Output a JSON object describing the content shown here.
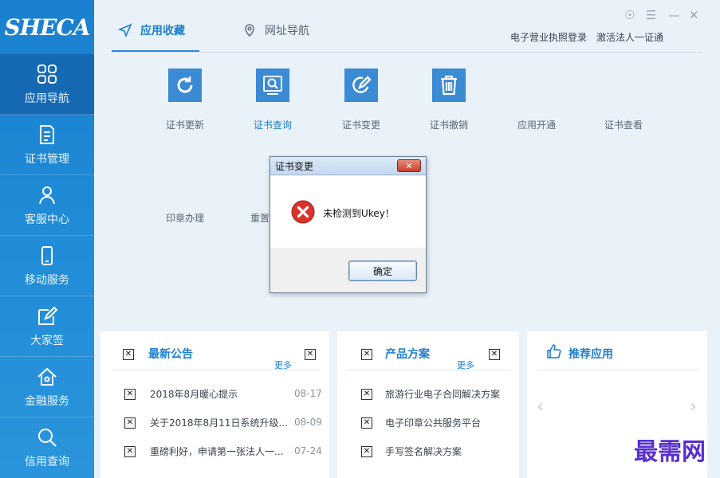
{
  "sidebar": {
    "logo": "SHECA",
    "items": [
      {
        "label": "应用导航",
        "icon": "grid-icon"
      },
      {
        "label": "证书管理",
        "icon": "document-icon"
      },
      {
        "label": "客服中心",
        "icon": "user-icon"
      },
      {
        "label": "移动服务",
        "icon": "phone-icon"
      },
      {
        "label": "大家签",
        "icon": "pen-icon"
      },
      {
        "label": "金融服务",
        "icon": "house-icon"
      },
      {
        "label": "信用查询",
        "icon": "search-icon"
      }
    ]
  },
  "header": {
    "tabs": [
      {
        "label": "应用收藏",
        "icon": "send-icon"
      },
      {
        "label": "网址导航",
        "icon": "location-pin-icon"
      }
    ],
    "links": [
      "电子营业执照登录",
      "激活法人一证通"
    ]
  },
  "apps": [
    {
      "label": "证书更新",
      "icon": "refresh-icon"
    },
    {
      "label": "证书查询",
      "icon": "magnifier-icon"
    },
    {
      "label": "证书变更",
      "icon": "edit-icon"
    },
    {
      "label": "证书撤销",
      "icon": "trash-icon"
    },
    {
      "label": "应用开通",
      "icon": ""
    },
    {
      "label": "证书查看",
      "icon": ""
    },
    {
      "label": "印章办理",
      "icon": ""
    },
    {
      "label": "重置",
      "icon": ""
    }
  ],
  "notices": {
    "title": "最新公告",
    "more": "更多",
    "items": [
      {
        "text": "2018年8月暖心提示",
        "date": "08-17"
      },
      {
        "text": "关于2018年8月11日系统升级...",
        "date": "08-09"
      },
      {
        "text": "重磅利好，申请第一张法人一...",
        "date": "07-24"
      }
    ]
  },
  "products": {
    "title": "产品方案",
    "more": "更多",
    "items": [
      {
        "text": "旅游行业电子合同解决方案"
      },
      {
        "text": "电子印章公共服务平台"
      },
      {
        "text": "手写签名解决方案"
      }
    ]
  },
  "recommend": {
    "title": "推荐应用",
    "prev": "‹",
    "next": "›"
  },
  "dialog": {
    "title": "证书变更",
    "close": "✕",
    "message": "未检测到Ukey！",
    "ok": "确定"
  },
  "watermark": "最需网",
  "colors": {
    "accent": "#1f7fcf",
    "sidebar": "#1a7fd0",
    "error": "#d9332b",
    "watermark": "#5a2fd1"
  }
}
